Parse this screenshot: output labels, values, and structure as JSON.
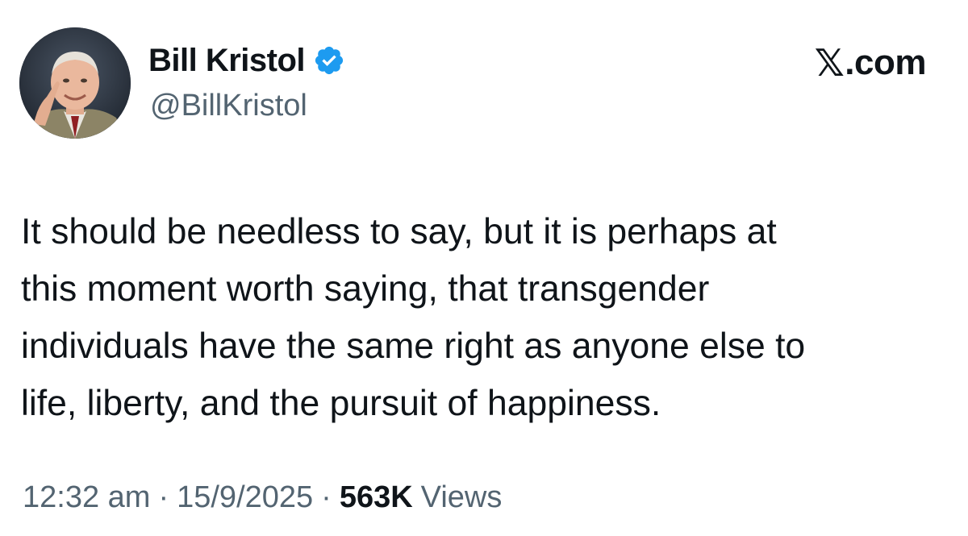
{
  "author": {
    "display_name": "Bill Kristol",
    "handle": "@BillKristol",
    "verified": true,
    "avatar_icon": "profile-photo",
    "verified_color": "#1d9bf0"
  },
  "brand": {
    "icon": "x-logo-icon",
    "icon_glyph": "𝕏",
    "text": ".com"
  },
  "tweet": {
    "lines": [
      "It should be needless to say, but it is perhaps at",
      "this moment worth saying, that transgender",
      "individuals have the same right as anyone else to",
      "life, liberty, and the pursuit of happiness."
    ]
  },
  "meta": {
    "time": "12:32 am",
    "separator": "·",
    "date": "15/9/2025",
    "views_count": "563K",
    "views_label": "Views"
  },
  "colors": {
    "text_primary": "#0f1419",
    "text_secondary": "#536471",
    "background": "#ffffff"
  }
}
